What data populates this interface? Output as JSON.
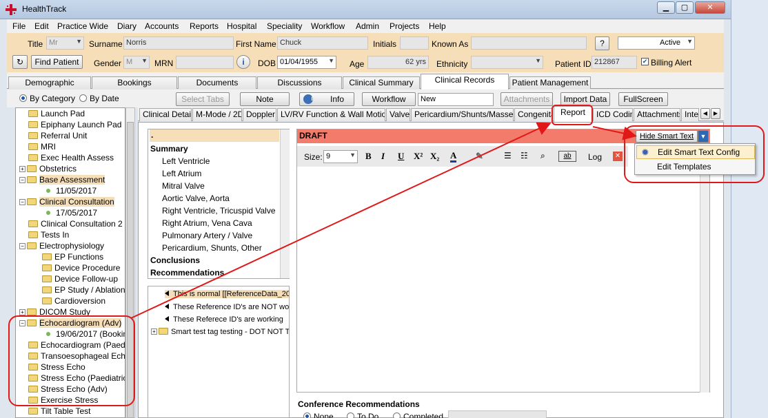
{
  "window": {
    "title": "HealthTrack"
  },
  "menu": [
    "File",
    "Edit",
    "Practice Wide",
    "Diary",
    "Accounts",
    "Reports",
    "Hospital",
    "Speciality",
    "Workflow",
    "Admin",
    "Projects",
    "Help"
  ],
  "patient": {
    "title_label": "Title",
    "title_value": "Mr",
    "surname_label": "Surname",
    "surname_value": "Norris",
    "first_name_label": "First Name",
    "first_name_value": "Chuck",
    "initials_label": "Initials",
    "known_as_label": "Known As",
    "help_btn": "?",
    "status_value": "Active",
    "find_patient": "Find Patient",
    "gender_label": "Gender",
    "gender_value": "M",
    "mrn_label": "MRN",
    "dob_label": "DOB",
    "dob_value": "01/04/1955",
    "age_label": "Age",
    "age_value": "62 yrs",
    "ethnicity_label": "Ethnicity",
    "patient_id_label": "Patient ID",
    "patient_id_value": "212867",
    "billing_alert": "Billing Alert"
  },
  "main_tabs": [
    "Demographic",
    "Bookings",
    "Documents",
    "Discussions",
    "Clinical Summary",
    "Clinical Records",
    "Patient Management"
  ],
  "toolbar": {
    "by_category": "By Category",
    "by_date": "By Date",
    "select_tabs": "Select Tabs",
    "note": "Note",
    "info": "Info",
    "workflow": "Workflow",
    "workflow_value": "New",
    "attachments": "Attachments",
    "import_data": "Import Data",
    "fullscreen": "FullScreen"
  },
  "tree": [
    {
      "label": "Launch Pad",
      "type": "folder"
    },
    {
      "label": "Epiphany Launch Pad",
      "type": "folder"
    },
    {
      "label": "Referral Unit",
      "type": "folder"
    },
    {
      "label": "MRI",
      "type": "folder"
    },
    {
      "label": "Exec Health Assess",
      "type": "folder"
    },
    {
      "label": "Obstetrics",
      "type": "folder"
    },
    {
      "label": "Base Assessment",
      "type": "folder"
    },
    {
      "label": "11/05/2017",
      "type": "item"
    },
    {
      "label": "Clinical Consultation",
      "type": "folder"
    },
    {
      "label": "17/05/2017",
      "type": "item"
    },
    {
      "label": "Clinical Consultation 2",
      "type": "folder"
    },
    {
      "label": "Tests In",
      "type": "folder"
    },
    {
      "label": "Electrophysiology",
      "type": "folder"
    },
    {
      "label": "EP Functions",
      "type": "folder"
    },
    {
      "label": "Device Procedure",
      "type": "folder"
    },
    {
      "label": "Device Follow-up",
      "type": "folder"
    },
    {
      "label": "EP Study / Ablation",
      "type": "folder"
    },
    {
      "label": "Cardioversion",
      "type": "folder"
    },
    {
      "label": "DICOM Study",
      "type": "folder"
    },
    {
      "label": "Echocardiogram (Adv)",
      "type": "folder"
    },
    {
      "label": "19/06/2017 (Bookin",
      "type": "item"
    },
    {
      "label": "Echocardiogram (Paedia",
      "type": "folder"
    },
    {
      "label": "Transoesophageal Echo",
      "type": "folder"
    },
    {
      "label": "Stress Echo",
      "type": "folder"
    },
    {
      "label": "Stress Echo (Paediatric)",
      "type": "folder"
    },
    {
      "label": "Stress Echo (Adv)",
      "type": "folder"
    },
    {
      "label": "Exercise Stress",
      "type": "folder"
    },
    {
      "label": "Tilt Table Test",
      "type": "folder"
    }
  ],
  "sub_tabs": [
    "Clinical Detail",
    "M-Mode / 2D",
    "Doppler",
    "LV/RV Function & Wall Motion",
    "Valve",
    "Pericardium/Shunts/Masses",
    "Congenital",
    "Report",
    "ICD Coding",
    "Attachments",
    "Inte"
  ],
  "sections": {
    "dot": ".",
    "summary": "Summary",
    "items": [
      "Left Ventricle",
      "Left Atrium",
      "Mitral Valve",
      "Aortic Valve, Aorta",
      "Right Ventricle, Tricuspid Valve",
      "Right Atrium, Vena Cava",
      "Pulmonary Artery / Valve",
      "Pericardium, Shunts, Other"
    ],
    "conclusions": "Conclusions",
    "recommendations": "Recommendations"
  },
  "refs": [
    "This is normal [[ReferenceData_20",
    "These Reference ID's are NOT wor",
    "These Referece ID's are working",
    "Smart test tag testing - DOT NOT T"
  ],
  "editor": {
    "draft": "DRAFT",
    "size_label": "Size:",
    "size_value": "9",
    "log": "Log",
    "hide_smart_text": "Hide Smart Text"
  },
  "smart_menu": [
    "Edit Smart Text Config",
    "Edit Templates"
  ],
  "conference": {
    "title": "Conference Recommendations",
    "options": [
      "None",
      "To Do",
      "Completed"
    ]
  },
  "colors": {
    "patient_bar": "#f6dfb8",
    "draft_bar": "#f37b6b",
    "annotation": "#e01818"
  }
}
